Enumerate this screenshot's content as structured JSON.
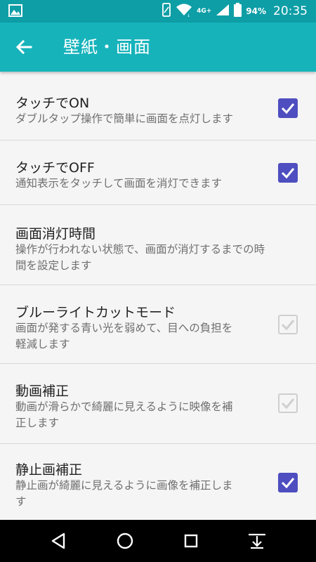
{
  "status_bar": {
    "battery_percent": "94%",
    "network": "4G+",
    "time": "20:35"
  },
  "app_bar": {
    "title": "壁紙・画面"
  },
  "settings": [
    {
      "title": "タッチでON",
      "summary": "ダブルタップ操作で簡単に画面を点灯します",
      "checked": true,
      "enabled": true
    },
    {
      "title": "タッチでOFF",
      "summary": "通知表示をタッチして画面を消灯できます",
      "checked": true,
      "enabled": true
    },
    {
      "title": "画面消灯時間",
      "summary_lines": [
        "操作が行われない状態で、画面が消灯するまでの時",
        "間を設定します"
      ]
    },
    {
      "title": "ブルーライトカットモード",
      "summary_lines": [
        "画面が発する青い光を弱めて、目への負担を",
        "軽減します"
      ],
      "checked": true,
      "enabled": false
    },
    {
      "title": "動画補正",
      "summary_lines": [
        "動画が滑らかで綺麗に見えるように映像を補",
        "正します"
      ],
      "checked": true,
      "enabled": false
    },
    {
      "title": "静止画補正",
      "summary_lines": [
        "静止画が綺麗に見えるように画像を補正しま",
        "す"
      ],
      "checked": true,
      "enabled": true
    }
  ],
  "icons": {
    "status_left": "image-icon",
    "signal": "signal-icon",
    "wifi": "wifi-icon",
    "battery": "battery-icon",
    "back": "arrow-left-icon",
    "nav_back": "nav-back-triangle-icon",
    "nav_home": "nav-home-circle-icon",
    "nav_recents": "nav-recents-square-icon",
    "nav_menu": "nav-menu-down-icon"
  },
  "colors": {
    "status_bar": "#0e9ea6",
    "app_bar": "#16b3bb",
    "checkbox_checked": "#4e4ec0",
    "checkbox_disabled": "#cfcfcf"
  }
}
